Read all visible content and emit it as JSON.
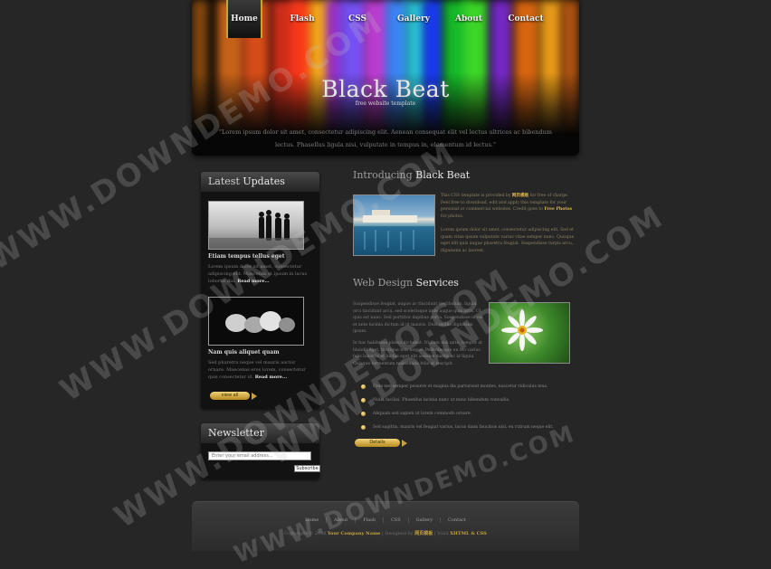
{
  "nav": [
    "Home",
    "Flash",
    "CSS",
    "Gallery",
    "About",
    "Contact"
  ],
  "header": {
    "title": "Black Beat",
    "tagline": "free website template",
    "intro": "\"Lorem ipsum dolor sit amet, consectetur adipiscing elit. Aenean consequat elit vel lectus ultrices ac bibendum lectus. Phasellus ligula nisi, vulputate in tempus in, elementum id lectus.\""
  },
  "sidebar": {
    "updates_title_1": "Latest",
    "updates_title_2": "Updates",
    "post1_title": "Etiam tempus tellus eget",
    "post1_text": "Lorem ipsum dolor sit amet, consectetur adipiscing elit. Maecenas et ipsum in lacus lobortis dui.",
    "post2_title": "Nam quis aliquet quam",
    "post2_text": "Sed pharetra neque vel mauris auctor ornare. Maecenas eros lorem, consectetur quis consectetur id.",
    "read_more": "Read more...",
    "view_all": "view all",
    "newsletter_title": "Newsletter",
    "email_placeholder": "Enter your email address...",
    "subscribe": "Subscribe"
  },
  "main": {
    "intro_head_1": "Introducing",
    "intro_head_2": "Black Beat",
    "intro_p1_a": "This CSS template is provided by",
    "intro_p1_link": "网页模板",
    "intro_p1_b": "for free of charge. Feel free to download, edit and apply this template for your personal or commercial websites. Credit goes to",
    "intro_p1_link2": "Free Photos",
    "intro_p1_c": "for photos.",
    "intro_p2": "Lorem ipsum dolor sit amet, consectetur adipiscing elit. Sed et quam vitae ipsum vulputate varius vitae semper nunc. Quisque eget elit quis augue pharetra feugiat. Suspendisse turpis arcu, dignissim ac laoreet.",
    "services_head_1": "Web Design",
    "services_head_2": "Services",
    "services_p1": "Suspendisse feugiat, augue ac tincidunt vestibulum, ligula orci tincidunt arcu, sed scelerisque ante augue quis arcu. Ut quis est nunc. Sed porttitor dapibus porta. Suspendisse in est et ante lacinia dictum id id mauris. Duis mollis dignissim ipsum.",
    "services_p2": "In hac habitasse platea dictumst. Nullam nisi ante, tempor at blandit eget, tristique non neque. Pellentesque eu leo varius felis lobortis et luctus eget elit sodales mattis ac id ligula. Quisque fermentum malesuada felis at suscipit.",
    "bullets": [
      "Cras nec semper posuere et magnis dis parturient montes, nascetur ridiculus mus.",
      "Nulla facilisi. Phasellus lacinia nunc ut nunc bibendum convallis.",
      "Aliquam sed sapien ut lorem commodo ornare.",
      "Sed sagittis, mauris vel feugiat varius, lacus diam faucibus nisl, eu rutrum neque elit."
    ],
    "detail": "Details"
  },
  "footer": {
    "nav": [
      "Home",
      "About",
      "Flash",
      "CSS",
      "Gallery",
      "Contact"
    ],
    "copyright_a": "Copyright © 2048",
    "copyright_company": "Your Company Name",
    "copyright_b": "| Designed by",
    "copyright_designer": "网页模板",
    "copyright_c": "| Valid",
    "copyright_valid": "XHTML & CSS"
  },
  "watermark": "WWW.DOWNDEMO.COM"
}
